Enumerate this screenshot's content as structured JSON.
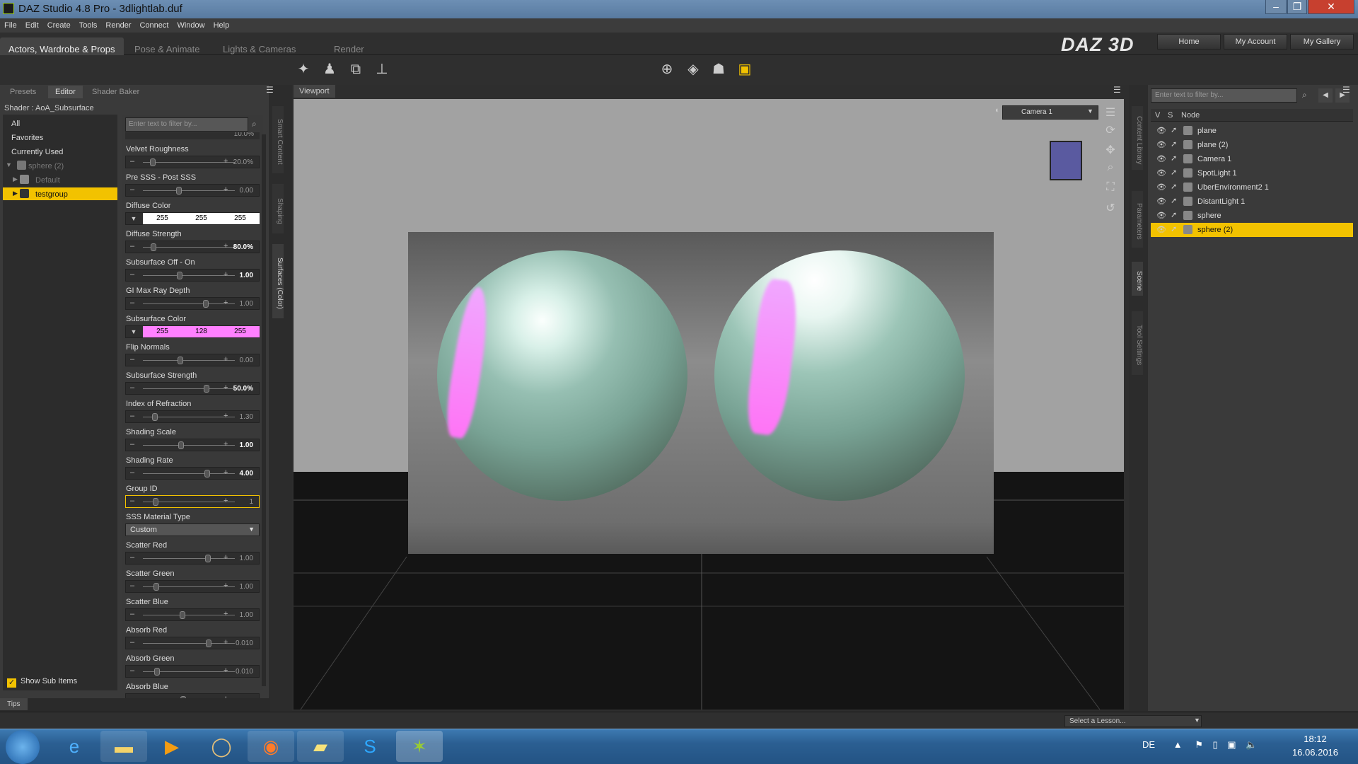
{
  "window": {
    "title": "DAZ Studio 4.8 Pro - 3dlightlab.duf"
  },
  "menu": [
    "File",
    "Edit",
    "Create",
    "Tools",
    "Render",
    "Connect",
    "Window",
    "Help"
  ],
  "rooms": [
    "Actors, Wardrobe & Props",
    "Pose & Animate",
    "Lights & Cameras",
    "Render"
  ],
  "header_buttons": [
    "Home",
    "My Account",
    "My Gallery"
  ],
  "logo": "DAZ 3D",
  "left_tabs": [
    "Presets",
    "Editor",
    "Shader Baker"
  ],
  "shader_label": "Shader : AoA_Subsurface",
  "left_list": [
    {
      "label": "All",
      "state": "normal"
    },
    {
      "label": "Favorites",
      "state": "normal"
    },
    {
      "label": "Currently Used",
      "state": "normal"
    },
    {
      "label": "sphere (2)",
      "state": "dim"
    },
    {
      "label": "Default",
      "state": "dim"
    },
    {
      "label": "testgroup",
      "state": "selected"
    }
  ],
  "filter_placeholder": "Enter text to filter by...",
  "top_cut_value": "10.0%",
  "properties": [
    {
      "name": "Velvet Roughness",
      "value": "20.0%",
      "bright": false
    },
    {
      "name": "Pre SSS - Post SSS",
      "value": "0.00",
      "bright": false
    },
    {
      "name": "Diffuse Color",
      "color": [
        "255",
        "255",
        "255"
      ],
      "swatch": "#ffffff"
    },
    {
      "name": "Diffuse Strength",
      "value": "80.0%",
      "bright": true
    },
    {
      "name": "Subsurface Off - On",
      "value": "1.00",
      "bright": true
    },
    {
      "name": "GI Max Ray Depth",
      "value": "1.00",
      "bright": false
    },
    {
      "name": "Subsurface Color",
      "color": [
        "255",
        "128",
        "255"
      ],
      "swatch": "#ff80ff"
    },
    {
      "name": "Flip Normals",
      "value": "0.00",
      "bright": false
    },
    {
      "name": "Subsurface Strength",
      "value": "50.0%",
      "bright": true
    },
    {
      "name": "Index of Refraction",
      "value": "1.30",
      "bright": false
    },
    {
      "name": "Shading Scale",
      "value": "1.00",
      "bright": true
    },
    {
      "name": "Shading Rate",
      "value": "4.00",
      "bright": true
    },
    {
      "name": "Group ID",
      "value": "1",
      "bright": false,
      "highlight": true
    },
    {
      "name": "SSS Material Type",
      "combo": "Custom"
    },
    {
      "name": "Scatter Red",
      "value": "1.00",
      "bright": false
    },
    {
      "name": "Scatter Green",
      "value": "1.00",
      "bright": false
    },
    {
      "name": "Scatter Blue",
      "value": "1.00",
      "bright": false
    },
    {
      "name": "Absorb Red",
      "value": "0.010",
      "bright": false
    },
    {
      "name": "Absorb Green",
      "value": "0.010",
      "bright": false
    },
    {
      "name": "Absorb Blue",
      "value": "",
      "bright": false
    }
  ],
  "show_sub_items": "Show Sub Items",
  "side_tabs_left": [
    "Smart Content",
    "Shaping",
    "Surfaces (Color)"
  ],
  "side_tabs_right": [
    "Content Library",
    "Parameters",
    "Scene",
    "Tool Settings"
  ],
  "viewport": {
    "tab": "Viewport",
    "camera": "Camera 1"
  },
  "scene": {
    "filter_placeholder": "Enter text to filter by...",
    "columns": [
      "V",
      "S",
      "Node"
    ],
    "rows": [
      {
        "label": "plane",
        "selected": false
      },
      {
        "label": "plane (2)",
        "selected": false
      },
      {
        "label": "Camera 1",
        "selected": false
      },
      {
        "label": "SpotLight 1",
        "selected": false
      },
      {
        "label": "UberEnvironment2 1",
        "selected": false
      },
      {
        "label": "DistantLight 1",
        "selected": false
      },
      {
        "label": "sphere",
        "selected": false
      },
      {
        "label": "sphere (2)",
        "selected": true
      }
    ]
  },
  "tips": "Tips",
  "lesson": "Select a Lesson...",
  "taskbar": {
    "lang": "DE",
    "time": "18:12",
    "date": "16.06.2016"
  }
}
